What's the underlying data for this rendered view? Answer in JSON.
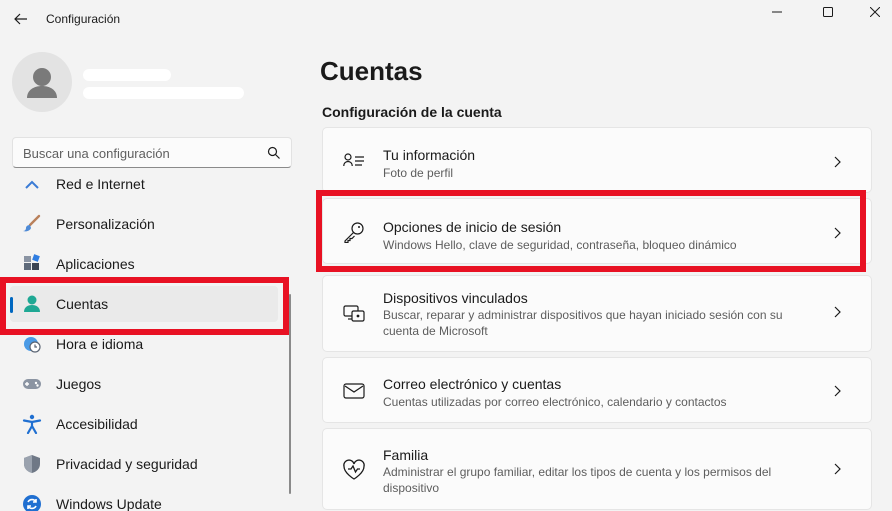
{
  "window": {
    "title": "Configuración"
  },
  "search": {
    "placeholder": "Buscar una configuración"
  },
  "sidebar": {
    "items": [
      {
        "label": "Red e Internet",
        "icon": "network-icon"
      },
      {
        "label": "Personalización",
        "icon": "brush-icon"
      },
      {
        "label": "Aplicaciones",
        "icon": "apps-icon"
      },
      {
        "label": "Cuentas",
        "icon": "account-icon",
        "selected": true
      },
      {
        "label": "Hora e idioma",
        "icon": "clock-globe-icon"
      },
      {
        "label": "Juegos",
        "icon": "gamepad-icon"
      },
      {
        "label": "Accesibilidad",
        "icon": "accessibility-icon"
      },
      {
        "label": "Privacidad y seguridad",
        "icon": "shield-icon"
      },
      {
        "label": "Windows Update",
        "icon": "update-icon"
      }
    ]
  },
  "main": {
    "title": "Cuentas",
    "section": "Configuración de la cuenta",
    "cards": [
      {
        "title": "Tu información",
        "subtitle": "Foto de perfil",
        "icon": "person-info-icon"
      },
      {
        "title": "Opciones de inicio de sesión",
        "subtitle": "Windows Hello, clave de seguridad, contraseña, bloqueo dinámico",
        "icon": "key-icon"
      },
      {
        "title": "Dispositivos vinculados",
        "subtitle": "Buscar, reparar y administrar dispositivos que hayan iniciado sesión con su cuenta de Microsoft",
        "icon": "linked-devices-icon"
      },
      {
        "title": "Correo electrónico y cuentas",
        "subtitle": "Cuentas utilizadas por correo electrónico, calendario y contactos",
        "icon": "mail-icon"
      },
      {
        "title": "Familia",
        "subtitle": "Administrar el grupo familiar, editar los tipos de cuenta y los permisos del dispositivo",
        "icon": "family-icon"
      }
    ]
  },
  "colors": {
    "accent": "#0067c0",
    "highlight": "#e81123",
    "background": "#f3f3f3",
    "card": "#fbfbfb"
  }
}
